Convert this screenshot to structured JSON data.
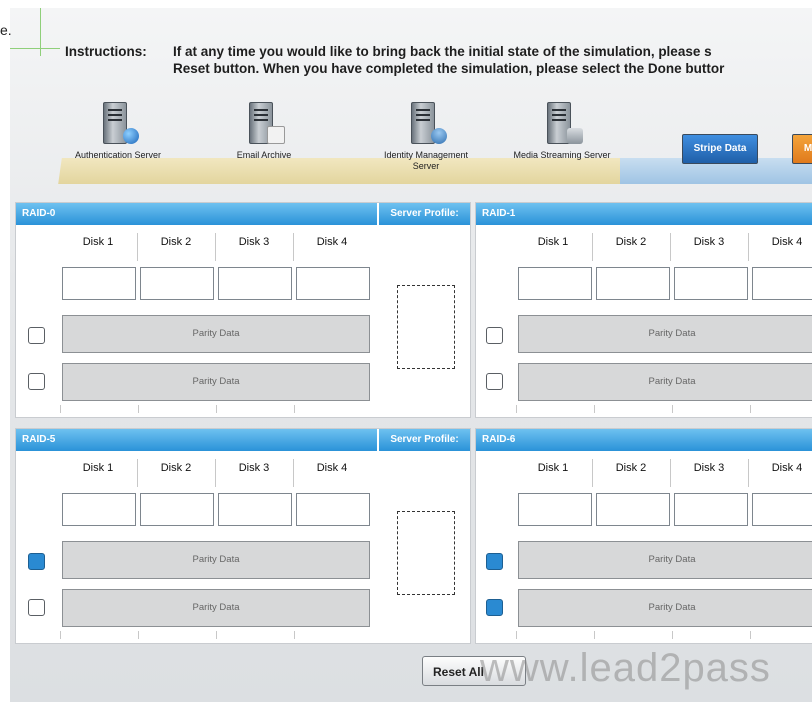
{
  "corner_text": "e.",
  "instructions": {
    "label": "Instructions:",
    "line1": "If at any time you would like to bring back the initial state of the simulation, please s",
    "line2": "Reset button. When you have completed the simulation, please select the Done buttor"
  },
  "servers": [
    {
      "name": "Authentication Server",
      "icon": "globe-server-icon"
    },
    {
      "name": "Email Archive",
      "icon": "email-server-icon"
    },
    {
      "name": "Identity Management Server",
      "icon": "identity-server-icon"
    },
    {
      "name": "Media Streaming Server",
      "icon": "database-server-icon"
    }
  ],
  "toolbar": {
    "stripe_data": "Stripe Data",
    "mirror": "M"
  },
  "panels": [
    {
      "title": "RAID-0",
      "profile_label": "Server Profile:",
      "disks": [
        "Disk 1",
        "Disk 2",
        "Disk 3",
        "Disk 4"
      ],
      "parity": [
        "Parity Data",
        "Parity Data"
      ],
      "checked": [
        false,
        false
      ]
    },
    {
      "title": "RAID-1",
      "disks": [
        "Disk 1",
        "Disk 2",
        "Disk 3",
        "Disk 4"
      ],
      "parity": [
        "Parity Data",
        "Parity Data"
      ],
      "checked": [
        false,
        false
      ]
    },
    {
      "title": "RAID-5",
      "profile_label": "Server Profile:",
      "disks": [
        "Disk 1",
        "Disk 2",
        "Disk 3",
        "Disk 4"
      ],
      "parity": [
        "Parity Data",
        "Parity Data"
      ],
      "checked": [
        true,
        false
      ]
    },
    {
      "title": "RAID-6",
      "disks": [
        "Disk 1",
        "Disk 2",
        "Disk 3",
        "Disk 4"
      ],
      "parity": [
        "Parity Data",
        "Parity Data"
      ],
      "checked": [
        true,
        true
      ]
    }
  ],
  "footer": {
    "reset": "Reset All",
    "watermark": "www.lead2pass"
  },
  "colors": {
    "header_blue": "#2a92d8",
    "checked_blue": "#2a8ad2",
    "stripe_btn": "#1f5fa8",
    "mirror_btn": "#e07a1c"
  }
}
